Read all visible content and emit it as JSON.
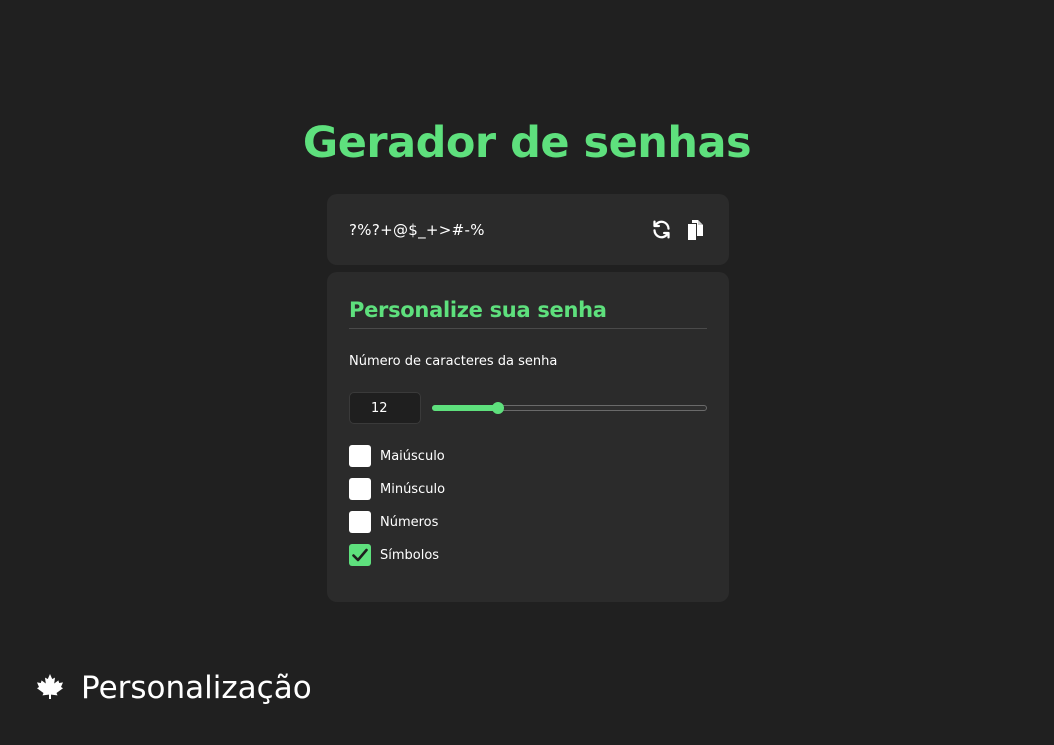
{
  "header": {
    "title": "Gerador de senhas"
  },
  "password": {
    "value": "?%?+@$_+>#-%",
    "refresh_icon": "refresh-icon",
    "copy_icon": "copy-icon"
  },
  "settings": {
    "title": "Personalize sua senha",
    "length_label": "Número de caracteres da senha",
    "length_value": "12",
    "slider_fraction": 0.24,
    "options": [
      {
        "label": "Maiúsculo",
        "checked": false
      },
      {
        "label": "Minúsculo",
        "checked": false
      },
      {
        "label": "Números",
        "checked": false
      },
      {
        "label": "Símbolos",
        "checked": true
      }
    ]
  },
  "footer": {
    "icon": "maple-leaf-icon",
    "label": "Personalização"
  },
  "colors": {
    "background": "#202020",
    "card": "#2b2b2b",
    "accent": "#5ee07d"
  }
}
